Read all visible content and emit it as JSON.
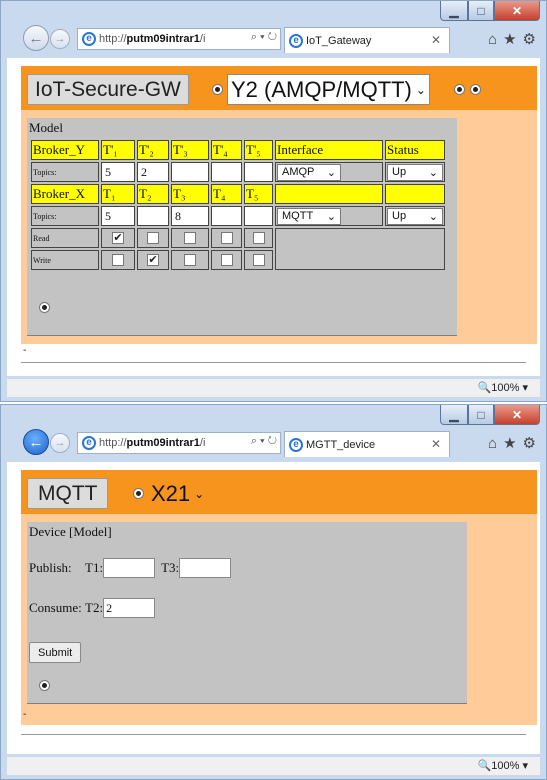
{
  "window1": {
    "address": {
      "prefix": "http://",
      "host": "putm09intrar1",
      "rest": "/i",
      "icons": "⌕ ▾ ↻"
    },
    "tab_title": "IoT_Gateway",
    "header": {
      "button": "IoT-Secure-GW",
      "select": "Y2 (AMQP/MQTT)"
    },
    "panel_title": "Model",
    "broker_y": {
      "name": "Broker_Y",
      "topics": [
        "T'₁",
        "T'₂",
        "T'₃",
        "T'₄",
        "T'₅"
      ],
      "interface_label": "Interface",
      "status_label": "Status",
      "row_label": "Topics:",
      "values": [
        "5",
        "2",
        "",
        "",
        ""
      ],
      "interface": "AMQP",
      "status": "Up"
    },
    "broker_x": {
      "name": "Broker_X",
      "topics": [
        "T₁",
        "T₂",
        "T₃",
        "T₄",
        "T₅"
      ],
      "row_label": "Topics:",
      "values": [
        "5",
        "",
        "8",
        "",
        ""
      ],
      "interface": "MQTT",
      "status": "Up"
    },
    "read_label": "Read",
    "write_label": "Write",
    "read": [
      true,
      false,
      false,
      false,
      false
    ],
    "write": [
      false,
      true,
      false,
      false,
      false
    ],
    "zoom": "100%"
  },
  "window2": {
    "address": {
      "prefix": "http://",
      "host": "putm09intrar1",
      "rest": "/i",
      "icons": "⌕ ▾ ↻"
    },
    "tab_title": "MGTT_device",
    "header": {
      "button": "MQTT",
      "select": "X21"
    },
    "panel_title": "Device [Model]",
    "publish_label": "Publish:",
    "t1_label": "T1:",
    "t1_value": "",
    "t3_label": "T3:",
    "t3_value": "",
    "consume_label": "Consume:",
    "t2_label": "T2:",
    "t2_value": "2",
    "submit": "Submit",
    "zoom": "100%"
  },
  "icons": {
    "back": "back-arrow-icon",
    "forward": "forward-arrow-icon",
    "home": "home-icon",
    "star": "star-icon",
    "gear": "gear-icon"
  }
}
